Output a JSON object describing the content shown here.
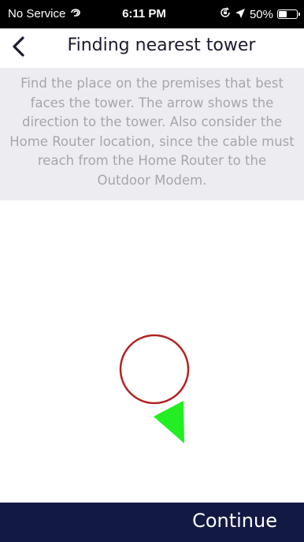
{
  "status_bar": {
    "carrier": "No Service",
    "time": "6:11 PM",
    "battery_percent": "50%",
    "battery_level": 0.5,
    "icons": [
      "wifi-calling-icon",
      "orientation-lock-icon",
      "location-arrow-icon",
      "battery-icon"
    ]
  },
  "header": {
    "title": "Finding nearest tower",
    "back_icon": "chevron-left-icon"
  },
  "instructions": {
    "text": "Find the place on the premises that best faces the tower. The arrow shows the direction to the tower. Also consider the Home Router location, since the cable must reach from the Home Router to the Outdoor Modem."
  },
  "compass": {
    "ring_color": "#b22222",
    "arrow_color": "#22ee22",
    "arrow_direction": "bottom-right"
  },
  "footer": {
    "continue_label": "Continue",
    "background_color": "#121a43"
  }
}
